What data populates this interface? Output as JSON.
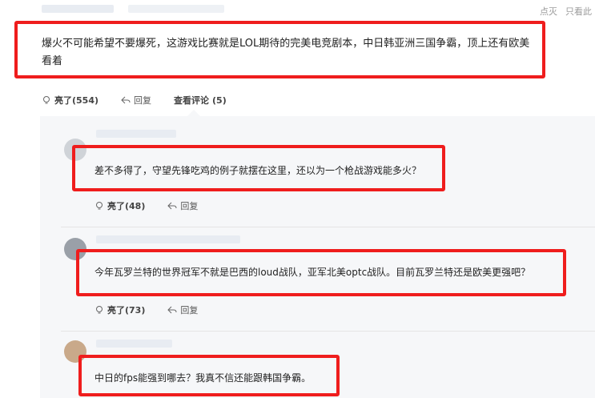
{
  "header": {
    "links": [
      "点灭",
      "只看此"
    ]
  },
  "main_comment": {
    "text": "爆火不可能希望不要爆死，这游戏比赛就是LOL期待的完美电竞剧本，中日韩亚洲三国争霸，顶上还有欧美看着",
    "actions": {
      "like_label": "亮了",
      "like_count": "(554)",
      "reply_label": "回复",
      "view_label": "查看评论",
      "view_count": "(5)"
    }
  },
  "replies": [
    {
      "text": "差不多得了，守望先锋吃鸡的例子就摆在这里，还以为一个枪战游戏能多火？",
      "like_label": "亮了",
      "like_count": "(48)",
      "reply_label": "回复"
    },
    {
      "text": "今年瓦罗兰特的世界冠军不就是巴西的loud战队，亚军北美optc战队。目前瓦罗兰特还是欧美更强吧？",
      "like_label": "亮了",
      "like_count": "(73)",
      "reply_label": "回复"
    },
    {
      "text": "中日的fps能强到哪去？我真不信还能跟韩国争霸。"
    }
  ],
  "colors": {
    "highlight_box": "#ef1d1d",
    "reply_background": "#f6f7f9",
    "text": "#222222",
    "muted": "#9a9a9a"
  }
}
